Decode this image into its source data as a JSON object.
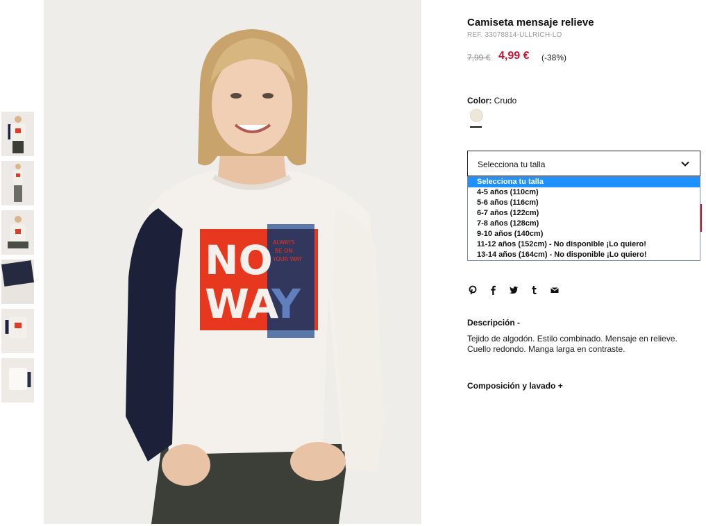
{
  "product": {
    "title": "Camiseta mensaje relieve",
    "ref": "REF. 33078814-ULLRICH-LO",
    "old_price": "7,99 €",
    "new_price": "4,99 €",
    "discount": "(-38%)"
  },
  "color": {
    "label": "Color:",
    "value": "Crudo",
    "swatch_hex": "#efe6da"
  },
  "size_select": {
    "current": "Selecciona tu talla",
    "options": [
      "Selecciona tu talla",
      "4-5 años (110cm)",
      "5-6 años (116cm)",
      "6-7 años (122cm)",
      "7-8 años (128cm)",
      "9-10 años (140cm)",
      "11-12 años (152cm) - No disponible ¡Lo quiero!",
      "13-14 años (164cm) - No disponible ¡Lo quiero!"
    ],
    "highlight_hex": "#1e90ff"
  },
  "social_icons": [
    "pinterest-icon",
    "facebook-icon",
    "twitter-icon",
    "tumblr-icon",
    "mail-icon"
  ],
  "description": {
    "title": "Descripción -",
    "text": "Tejido de algodón. Estilo combinado. Mensaje en relieve. Cuello redondo. Manga larga en contraste."
  },
  "composition": {
    "title": "Composición y lavado +"
  },
  "shirt_print": {
    "line1": "NO",
    "line2": "WA",
    "letter": "Y",
    "small": [
      "ALWAYS",
      "BE ON",
      "YOUR WAY"
    ]
  },
  "colors": {
    "price_red": "#d0102f",
    "print_red": "#e8371f",
    "print_blue": "#3f5f9a",
    "sleeve_navy": "#1c2038"
  }
}
